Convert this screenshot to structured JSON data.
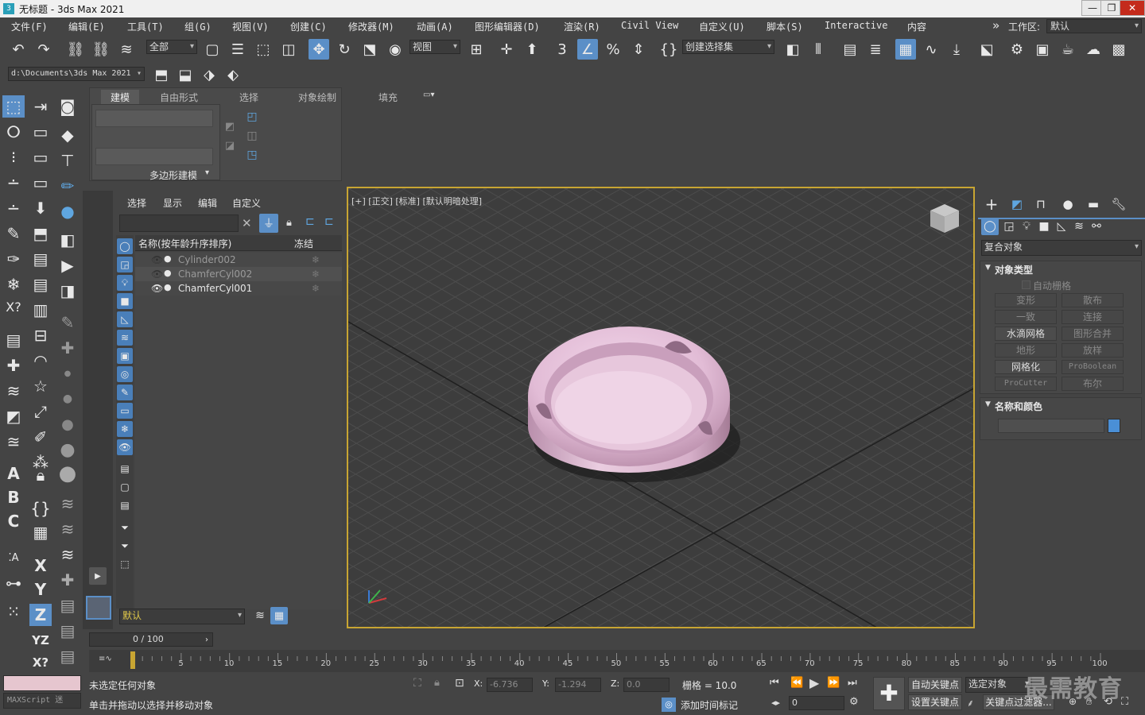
{
  "window": {
    "title": "无标题 - 3ds Max 2021",
    "minimize": "—",
    "restore": "❐",
    "close": "✕"
  },
  "menu": {
    "items": [
      "文件(F)",
      "编辑(E)",
      "工具(T)",
      "组(G)",
      "视图(V)",
      "创建(C)",
      "修改器(M)",
      "动画(A)",
      "图形编辑器(D)",
      "渲染(R)",
      "Civil View",
      "自定义(U)",
      "脚本(S)",
      "Interactive",
      "内容"
    ],
    "overflow": "»",
    "workspace_label": "工作区:",
    "workspace_value": "默认"
  },
  "toolbar": {
    "selection_filter": "全部",
    "ref_coord": "视图",
    "named_selection": "创建选择集",
    "project_path": "d:\\Documents\\3ds Max 2021"
  },
  "ribbon": {
    "tabs": [
      "建模",
      "自由形式",
      "选择",
      "对象绘制",
      "填充"
    ],
    "active_tab": "建模",
    "panel_label": "多边形建模"
  },
  "scene_explorer": {
    "tabs": [
      "选择",
      "显示",
      "编辑",
      "自定义"
    ],
    "col_name": "名称(按年龄升序排序)",
    "col_freeze": "冻结",
    "rows": [
      {
        "name": "Cylinder002",
        "visible": false
      },
      {
        "name": "ChamferCyl002",
        "visible": false
      },
      {
        "name": "ChamferCyl001",
        "visible": true
      }
    ],
    "layer_value": "默认"
  },
  "viewport": {
    "label": "[+] [正交] [标准] [默认明暗处理]"
  },
  "command_panel": {
    "category": "复合对象",
    "object_type_header": "对象类型",
    "auto_grid": "自动栅格",
    "buttons": [
      {
        "label": "变形",
        "enabled": false
      },
      {
        "label": "散布",
        "enabled": false
      },
      {
        "label": "一致",
        "enabled": false
      },
      {
        "label": "连接",
        "enabled": false
      },
      {
        "label": "水滴网格",
        "enabled": true
      },
      {
        "label": "图形合并",
        "enabled": false
      },
      {
        "label": "地形",
        "enabled": false
      },
      {
        "label": "放样",
        "enabled": false
      },
      {
        "label": "网格化",
        "enabled": true
      },
      {
        "label": "ProBoolean",
        "enabled": false
      },
      {
        "label": "ProCutter",
        "enabled": false
      },
      {
        "label": "布尔",
        "enabled": false
      }
    ],
    "name_color_header": "名称和颜色",
    "swatch_color": "#4a8fd6"
  },
  "timeline": {
    "frame": "0 / 100",
    "ticks": [
      "5",
      "10",
      "15",
      "20",
      "25",
      "30",
      "35",
      "40",
      "45",
      "50",
      "55",
      "60",
      "65",
      "70",
      "75",
      "80",
      "85",
      "90",
      "95",
      "100"
    ]
  },
  "status": {
    "maxscript": "MAXScript 迷",
    "line1": "未选定任何对象",
    "line2": "单击并拖动以选择并移动对象",
    "x_label": "X:",
    "x_value": "-6.736",
    "y_label": "Y:",
    "y_value": "-1.294",
    "z_label": "Z:",
    "z_value": "0.0",
    "grid": "栅格 = 10.0",
    "add_time_tag": "添加时间标记",
    "auto_key": "自动关键点",
    "selected_object": "选定对象",
    "set_key": "设置关键点",
    "key_filter": "关键点过滤器...",
    "frame_value": "0",
    "watermark": "最需教育"
  },
  "colors": {
    "accent": "#5b8fc7",
    "viewport_border": "#c8a532",
    "object": "#e8c6df"
  }
}
